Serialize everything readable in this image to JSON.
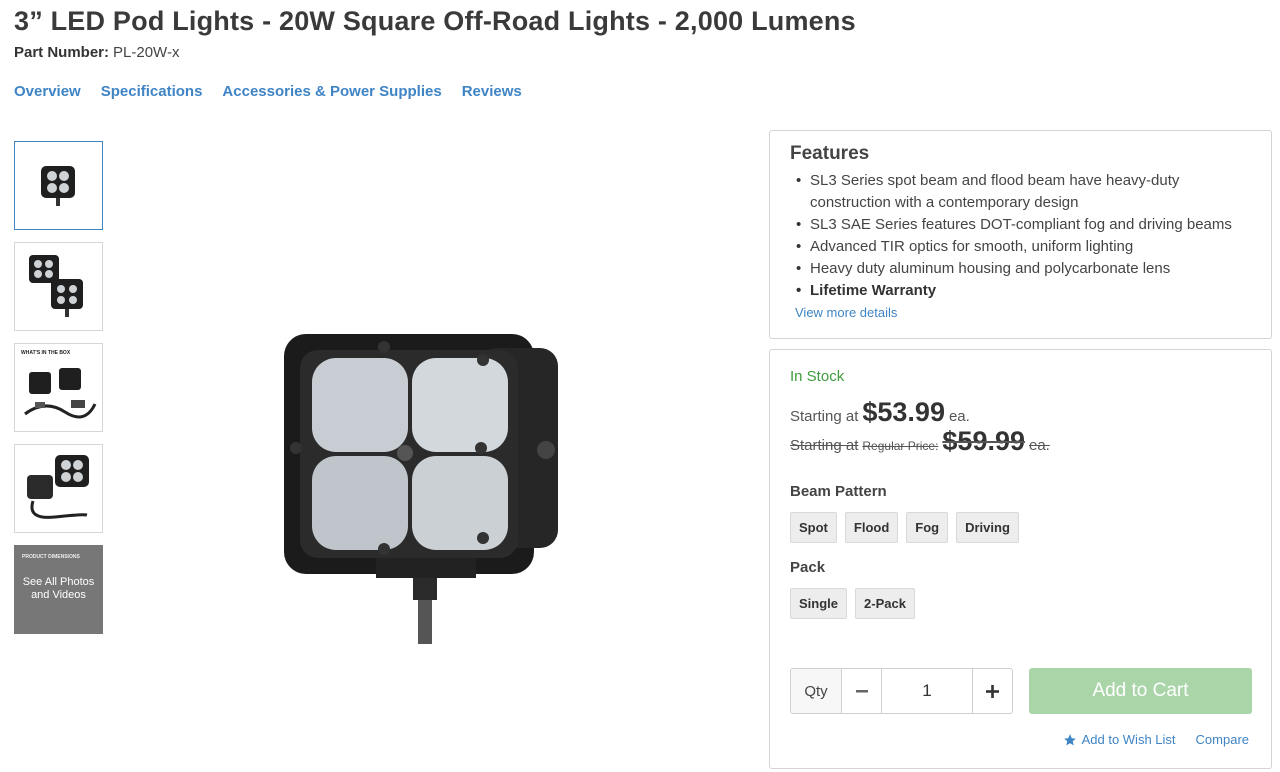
{
  "product": {
    "title": "3” LED Pod Lights - 20W Square Off-Road Lights - 2,000 Lumens",
    "part_number_label": "Part Number:",
    "part_number": "PL-20W-x"
  },
  "tabs": [
    "Overview",
    "Specifications",
    "Accessories & Power Supplies",
    "Reviews"
  ],
  "thumbnails": {
    "whats_in_box": "WHAT'S IN THE BOX",
    "product_dimensions": "PRODUCT DIMENSIONS",
    "see_all": "See All Photos and Videos"
  },
  "features": {
    "heading": "Features",
    "items": [
      "SL3 Series spot beam and flood beam have heavy-duty construction with a contemporary design",
      "SL3 SAE Series features DOT-compliant fog and driving beams",
      "Advanced TIR optics for smooth, uniform lighting",
      "Heavy duty aluminum housing and polycarbonate lens",
      "Lifetime Warranty"
    ],
    "more_link": "View more details"
  },
  "buy": {
    "stock": "In Stock",
    "starting_at": "Starting at",
    "price": "$53.99",
    "each": "ea.",
    "regular_label": "Regular Price:",
    "regular_price": "$59.99",
    "beam_label": "Beam Pattern",
    "beam_options": [
      "Spot",
      "Flood",
      "Fog",
      "Driving"
    ],
    "pack_label": "Pack",
    "pack_options": [
      "Single",
      "2-Pack"
    ],
    "qty_label": "Qty",
    "qty_value": "1",
    "add_to_cart": "Add to Cart",
    "wishlist": "Add to Wish List",
    "compare": "Compare"
  },
  "colors": {
    "link": "#3f84c4",
    "in_stock": "#3f9b3f",
    "cart_button": "#a9d5a9"
  }
}
